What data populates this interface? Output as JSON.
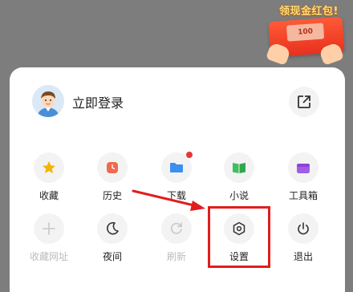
{
  "promo": {
    "text": "领现金红包!",
    "note_value": "100"
  },
  "login": {
    "label": "立即登录"
  },
  "grid": {
    "row1": [
      {
        "label": "收藏",
        "icon": "star-icon",
        "color": "#f5b400"
      },
      {
        "label": "历史",
        "icon": "clock-icon",
        "color": "#f06a4f"
      },
      {
        "label": "下载",
        "icon": "folder-icon",
        "color": "#3b8ff0",
        "badge": true
      },
      {
        "label": "小说",
        "icon": "book-icon",
        "color": "#3fbf5f"
      },
      {
        "label": "工具箱",
        "icon": "toolbox-icon",
        "color": "#a25ce8"
      }
    ],
    "row2": [
      {
        "label": "收藏网址",
        "icon": "plus-icon",
        "disabled": true
      },
      {
        "label": "夜间",
        "icon": "moon-icon"
      },
      {
        "label": "刷新",
        "icon": "refresh-icon",
        "disabled": true
      },
      {
        "label": "设置",
        "icon": "settings-icon"
      },
      {
        "label": "退出",
        "icon": "power-icon"
      }
    ]
  },
  "annotation": {
    "color": "#e21d1d"
  }
}
